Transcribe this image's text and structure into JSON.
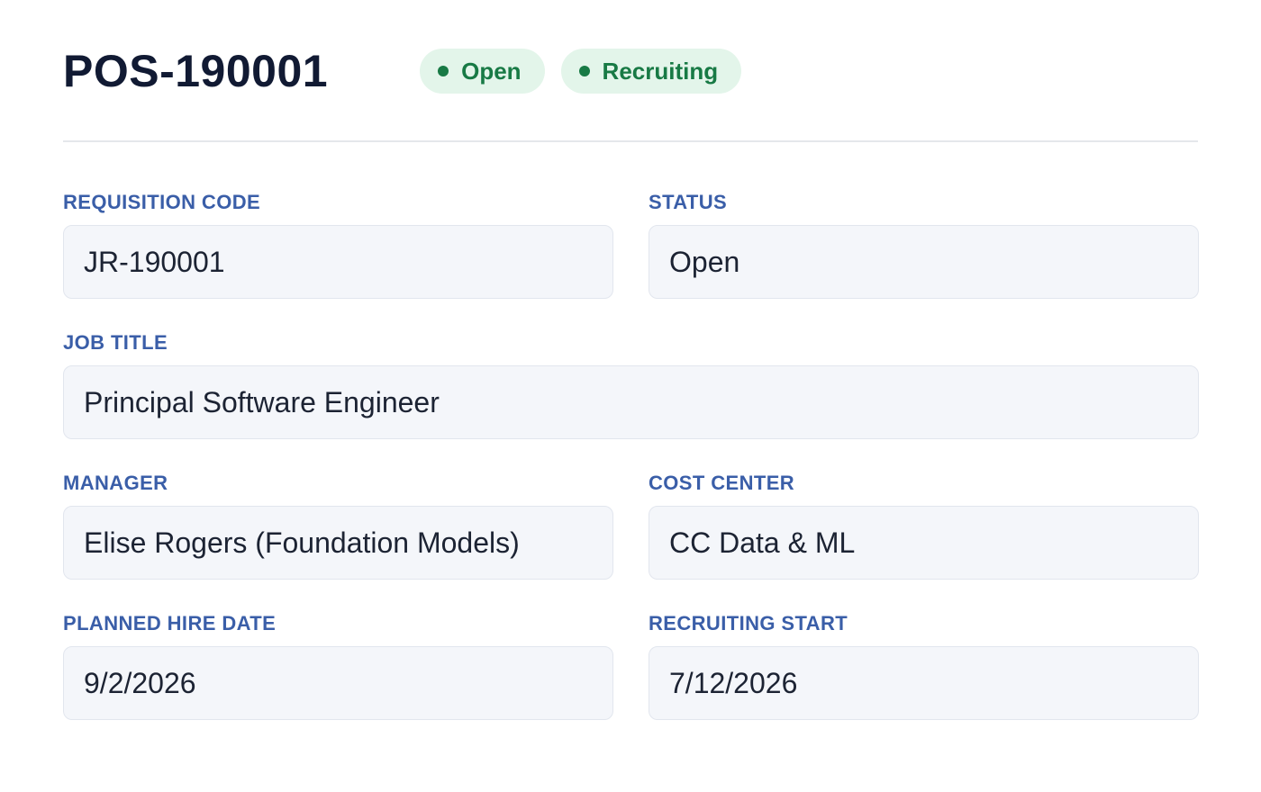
{
  "header": {
    "title": "POS-190001",
    "badges": [
      {
        "label": "Open",
        "color": "#187a45",
        "background": "#e3f5ea",
        "icon": "dot-icon"
      },
      {
        "label": "Recruiting",
        "color": "#187a45",
        "background": "#e3f5ea",
        "icon": "dot-icon"
      }
    ]
  },
  "fields": {
    "requisition_code": {
      "label": "REQUISITION CODE",
      "value": "JR-190001"
    },
    "status": {
      "label": "STATUS",
      "value": "Open"
    },
    "job_title": {
      "label": "JOB TITLE",
      "value": "Principal Software Engineer"
    },
    "manager": {
      "label": "MANAGER",
      "value": "Elise Rogers (Foundation Models)"
    },
    "cost_center": {
      "label": "COST CENTER",
      "value": "CC Data & ML"
    },
    "planned_hire_date": {
      "label": "PLANNED HIRE DATE",
      "value": "9/2/2026"
    },
    "recruiting_start": {
      "label": "RECRUITING START",
      "value": "7/12/2026"
    }
  },
  "colors": {
    "title": "#111a33",
    "label": "#3a5ea8",
    "field_background": "#f4f6fa",
    "field_border": "#e2e6ee",
    "badge_text": "#187a45",
    "badge_background": "#e3f5ea"
  }
}
